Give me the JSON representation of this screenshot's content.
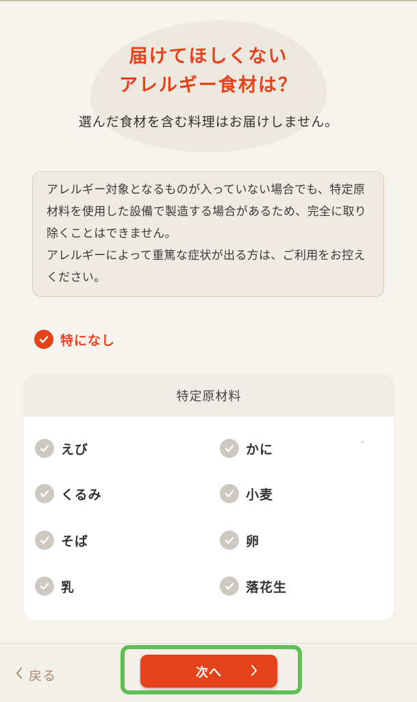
{
  "header": {
    "title_line1": "届けてほしくない",
    "title_line2": "アレルギー食材は？",
    "subtitle": "選んだ食材を含む料理はお届けしません。"
  },
  "notice": {
    "paragraph1": "アレルギー対象となるものが入っていない場合でも、特定原材料を使用した設備で製造する場合があるため、完全に取り除くことはできません。",
    "paragraph2": "アレルギーによって重篤な症状が出る方は、ご利用をお控えください。"
  },
  "none_option": {
    "label": "特になし",
    "checked": true
  },
  "allergen_card": {
    "heading": "特定原材料",
    "items": [
      {
        "label": "えび",
        "checked": false
      },
      {
        "label": "かに",
        "checked": false
      },
      {
        "label": "くるみ",
        "checked": false
      },
      {
        "label": "小麦",
        "checked": false
      },
      {
        "label": "そば",
        "checked": false
      },
      {
        "label": "卵",
        "checked": false
      },
      {
        "label": "乳",
        "checked": false
      },
      {
        "label": "落花生",
        "checked": false
      }
    ]
  },
  "footer": {
    "back_label": "戻る",
    "next_label": "次へ"
  },
  "colors": {
    "accent": "#e3421a",
    "unchecked": "#cdc8c1",
    "highlight": "#5fbf55",
    "back_text": "#a5896a"
  },
  "icons": {
    "check": "checkmark-icon",
    "back": "chevron-left-icon",
    "next": "chevron-right-icon"
  }
}
